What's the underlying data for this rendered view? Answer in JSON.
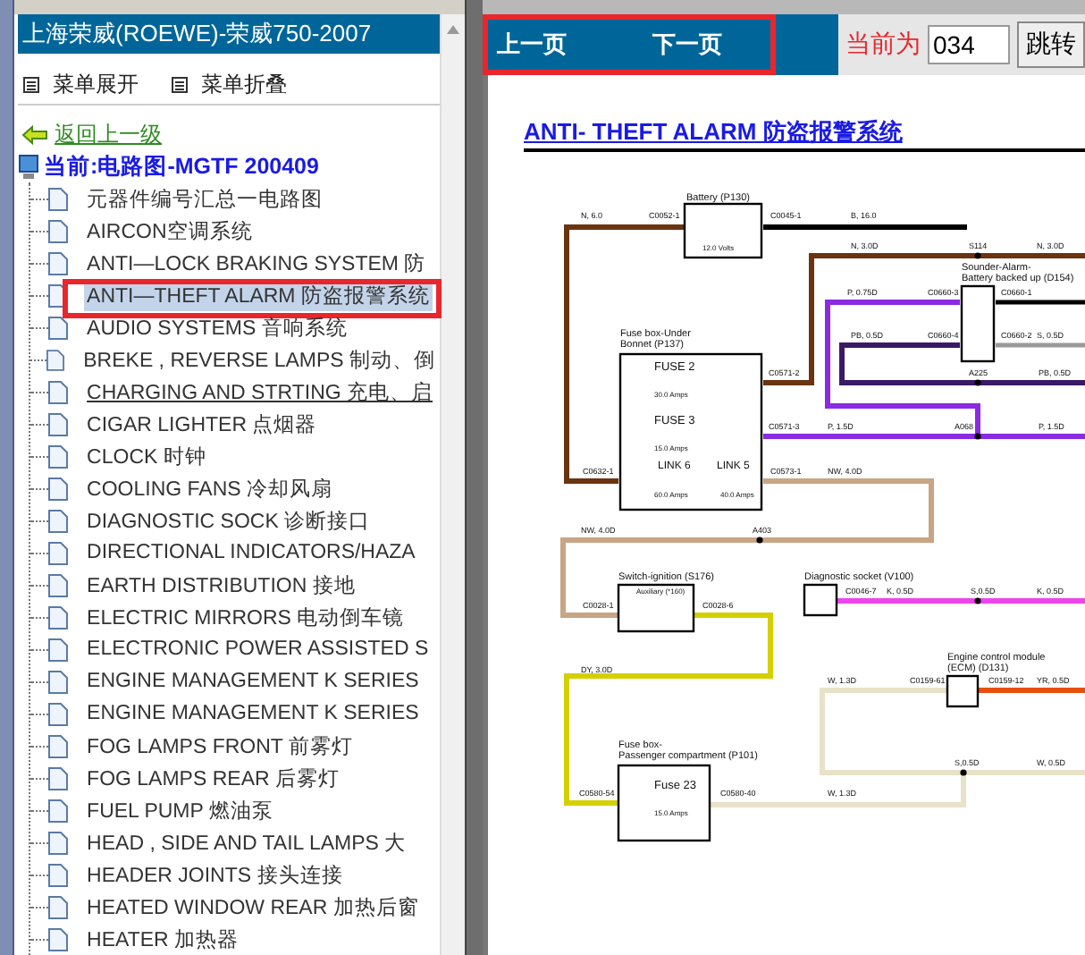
{
  "left_panel": {
    "title": "上海荣威(ROEWE)-荣威750-2007",
    "menu": [
      {
        "label": "菜单展开"
      },
      {
        "label": "菜单折叠"
      }
    ],
    "back_link": "返回上一级",
    "current": "当前:电路图-MGTF 200409",
    "items": [
      {
        "label": "元器件编号汇总一电路图",
        "selected": false,
        "underlined": false
      },
      {
        "label": "AIRCON空调系统",
        "selected": false,
        "underlined": false
      },
      {
        "label": "ANTI—LOCK BRAKING SYSTEM 防",
        "selected": false,
        "underlined": false
      },
      {
        "label": "ANTI—THEFT ALARM 防盗报警系统",
        "selected": true,
        "underlined": false
      },
      {
        "label": "AUDIO SYSTEMS 音响系统",
        "selected": false,
        "underlined": false
      },
      {
        "label": "BREKE , REVERSE LAMPS 制动、倒",
        "selected": false,
        "underlined": false
      },
      {
        "label": "CHARGING AND STRTING 充电、启",
        "selected": false,
        "underlined": true
      },
      {
        "label": "CIGAR LIGHTER 点烟器",
        "selected": false,
        "underlined": false
      },
      {
        "label": "CLOCK 时钟",
        "selected": false,
        "underlined": false
      },
      {
        "label": "COOLING FANS 冷却风扇",
        "selected": false,
        "underlined": false
      },
      {
        "label": "DIAGNOSTIC SOCK 诊断接口",
        "selected": false,
        "underlined": false
      },
      {
        "label": "DIRECTIONAL INDICATORS/HAZA",
        "selected": false,
        "underlined": false
      },
      {
        "label": "EARTH DISTRIBUTION 接地",
        "selected": false,
        "underlined": false
      },
      {
        "label": "ELECTRIC MIRRORS 电动倒车镜",
        "selected": false,
        "underlined": false
      },
      {
        "label": "ELECTRONIC POWER ASSISTED S",
        "selected": false,
        "underlined": false
      },
      {
        "label": "ENGINE MANAGEMENT K SERIES",
        "selected": false,
        "underlined": false
      },
      {
        "label": "ENGINE MANAGEMENT K SERIES",
        "selected": false,
        "underlined": false
      },
      {
        "label": "FOG LAMPS FRONT 前雾灯",
        "selected": false,
        "underlined": false
      },
      {
        "label": "FOG LAMPS REAR 后雾灯",
        "selected": false,
        "underlined": false
      },
      {
        "label": "FUEL PUMP 燃油泵",
        "selected": false,
        "underlined": false
      },
      {
        "label": "HEAD , SIDE AND TAIL LAMPS 大",
        "selected": false,
        "underlined": false
      },
      {
        "label": "HEADER JOINTS 接头连接",
        "selected": false,
        "underlined": false
      },
      {
        "label": "HEATED WINDOW REAR 加热后窗",
        "selected": false,
        "underlined": false
      },
      {
        "label": "HEATER 加热器",
        "selected": false,
        "underlined": false
      }
    ]
  },
  "nav": {
    "prev": "上一页",
    "next": "下一页",
    "current_label": "当前为",
    "page_value": "034",
    "jump_button": "跳转"
  },
  "document": {
    "title": "ANTI- THEFT ALARM 防盗报警系统",
    "diagram_labels": [
      "Battery (P130)",
      "N, 6.0",
      "C0052-1",
      "C0045-1",
      "B, 16.0",
      "12.0 Volts",
      "N, 3.0D",
      "S114",
      "N, 3.0D",
      "Sounder-Alarm-",
      "Battery backed up (D154)",
      "P, 0.75D",
      "C0660-3",
      "C0660-1",
      "Fuse box-Under",
      "PB, 0.5D",
      "C0660-4",
      "C0660-2",
      "S, 0.5D",
      "Bonnet (P137)",
      "FUSE 2",
      "C0571-2",
      "A225",
      "PB, 0.5D",
      "30.0 Amps",
      "FUSE 3",
      "C0571-3",
      "P, 1.5D",
      "A068",
      "P, 1.5D",
      "15.0 Amps",
      "C0632-1",
      "LINK 6",
      "LINK 5",
      "C0573-1",
      "NW, 4.0D",
      "60.0 Amps",
      "40.0 Amps",
      "NW, 4.0D",
      "A403",
      "Switch-ignition (S176)",
      "Diagnostic socket (V100)",
      "Auxiliary (*160)",
      "C0046-7",
      "K, 0.5D",
      "S,0.5D",
      "K, 0.5D",
      "C0028-1",
      "C0028-6",
      "Engine control module",
      "DY, 3.0D",
      "(ECM) (D131)",
      "W, 1.3D",
      "C0159-61",
      "C0159-12",
      "YR, 0.5D",
      "Fuse box-",
      "Passenger compartment (P101)",
      "S,0.5D",
      "W, 0.5D",
      "C0580-54",
      "Fuse 23",
      "C0580-40",
      "W, 1.3D",
      "15.0 Amps"
    ]
  }
}
